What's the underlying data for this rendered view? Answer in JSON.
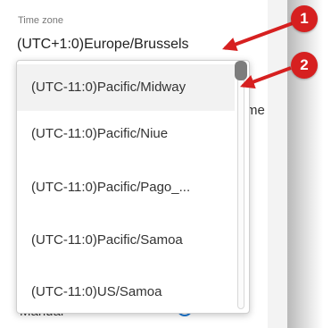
{
  "timezone_field": {
    "label": "Time zone",
    "value": "(UTC+1:0)Europe/Brussels"
  },
  "background": {
    "partial_text": "me",
    "manual_label": "Manual"
  },
  "dropdown": {
    "options": [
      "(UTC-11:0)Pacific/Midway",
      "(UTC-11:0)Pacific/Niue",
      "(UTC-11:0)Pacific/Pago_...",
      "(UTC-11:0)Pacific/Samoa",
      "(UTC-11:0)US/Samoa"
    ],
    "highlighted_option": "(UTC-11:0)Pacific/Midway"
  },
  "callouts": [
    "1",
    "2"
  ],
  "colors": {
    "callout": "#d62020",
    "radio": "#1976d2"
  }
}
